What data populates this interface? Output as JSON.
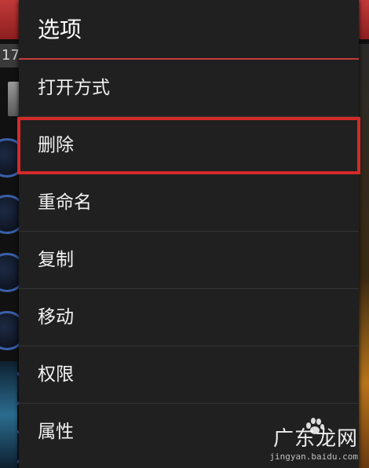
{
  "background": {
    "strip_text": "17",
    "accent_color": "#c23a3a"
  },
  "dialog": {
    "title": "选项",
    "highlight_color": "#d42a2a",
    "items": [
      {
        "label": "打开方式"
      },
      {
        "label": "删除",
        "highlighted": true
      },
      {
        "label": "重命名"
      },
      {
        "label": "复制"
      },
      {
        "label": "移动"
      },
      {
        "label": "权限"
      },
      {
        "label": "属性"
      }
    ]
  },
  "watermark": {
    "main": "广东龙网",
    "sub": "jingyan.baidu.com"
  }
}
